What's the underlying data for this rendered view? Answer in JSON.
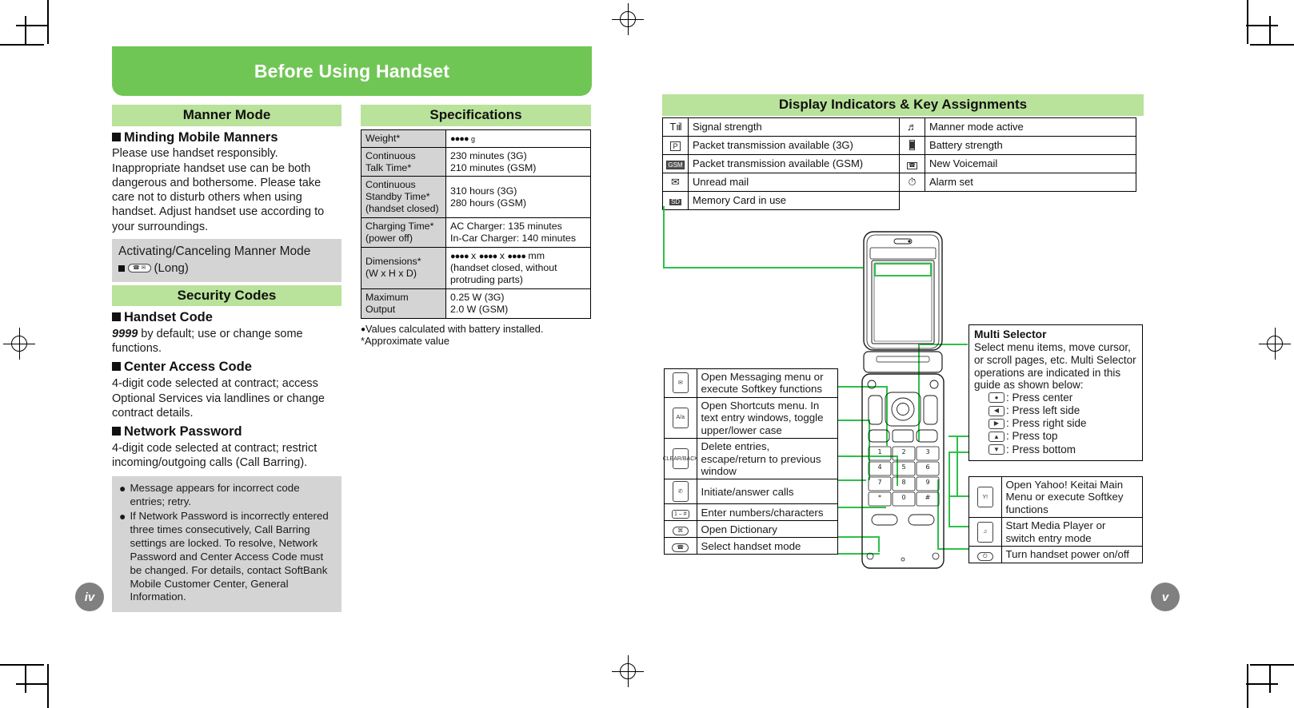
{
  "banner": {
    "title": "Before Using Handset"
  },
  "left_page": {
    "manner_mode": {
      "heading": "Manner Mode",
      "sub_heading": "Minding Mobile Manners",
      "body": "Please use handset responsibly. Inappropriate handset use can be both dangerous and bothersome. Please take care not to disturb others when using handset. Adjust handset use according to your surroundings.",
      "box_title": "Activating/Canceling Manner Mode",
      "box_key_label": "manner-key",
      "box_key_suffix": "(Long)"
    },
    "security_codes": {
      "heading": "Security Codes",
      "items": [
        {
          "title": "Handset Code",
          "emphasis": "9999",
          "body": " by default; use or change some functions."
        },
        {
          "title": "Center Access Code",
          "emphasis": "",
          "body": "4-digit code selected at contract; access Optional Services via landlines or change contract details."
        },
        {
          "title": "Network Password",
          "emphasis": "",
          "body": "4-digit code selected at contract; restrict incoming/outgoing calls (Call Barring)."
        }
      ],
      "notes": [
        "Message appears for incorrect code entries; retry.",
        "If Network Password is incorrectly entered three times consecutively, Call Barring settings are locked. To resolve, Network Password and Center Access Code must be changed. For details, contact SoftBank Mobile Customer Center, General Information."
      ]
    },
    "specifications": {
      "heading": "Specifications",
      "rows": [
        {
          "key": "Weight*",
          "value_lines": [
            "●● g"
          ]
        },
        {
          "key": "Continuous\nTalk Time*",
          "value_lines": [
            "230 minutes (3G)",
            "210 minutes (GSM)"
          ]
        },
        {
          "key": "Continuous\nStandby Time*\n(handset closed)",
          "value_lines": [
            "310 hours (3G)",
            "280 hours (GSM)"
          ]
        },
        {
          "key": "Charging Time*\n(power off)",
          "value_lines": [
            "AC Charger: 135 minutes",
            "In-Car Charger: 140 minutes"
          ]
        },
        {
          "key": "Dimensions*\n(W x H x D)",
          "value_lines": [
            "●● x ●● x ●● mm",
            "(handset closed, without",
            "protruding parts)"
          ]
        },
        {
          "key": "Maximum\nOutput",
          "value_lines": [
            "0.25 W (3G)",
            "2.0 W (GSM)"
          ]
        }
      ],
      "footnotes": [
        "Values calculated with battery installed.",
        "*Approximate value"
      ]
    }
  },
  "right_page": {
    "heading": "Display Indicators & Key Assignments",
    "indicators_left": [
      {
        "icon": "signal-strength-icon",
        "label": "Signal strength"
      },
      {
        "icon": "packet-3g-icon",
        "label": "Packet transmission available (3G)"
      },
      {
        "icon": "packet-gsm-icon",
        "label": "Packet transmission available (GSM)"
      },
      {
        "icon": "unread-mail-icon",
        "label": "Unread mail"
      },
      {
        "icon": "memory-card-icon",
        "label": "Memory Card in use"
      }
    ],
    "indicators_right": [
      {
        "icon": "manner-mode-icon",
        "label": "Manner mode active"
      },
      {
        "icon": "battery-icon",
        "label": "Battery strength"
      },
      {
        "icon": "voicemail-icon",
        "label": "New Voicemail"
      },
      {
        "icon": "alarm-icon",
        "label": "Alarm set"
      }
    ],
    "keys_left": [
      {
        "key_icon": "mail-key-icon",
        "key_caption": "✉",
        "label": "Open Messaging menu or execute Softkey functions"
      },
      {
        "key_icon": "shortcuts-key-icon",
        "key_caption": "A/a",
        "label": "Open Shortcuts menu. In text entry windows, toggle upper/lower case"
      },
      {
        "key_icon": "clear-back-key-icon",
        "key_caption": "CLEAR/BACK",
        "label": "Delete entries, escape/return to previous window"
      },
      {
        "key_icon": "call-key-icon",
        "key_caption": "✆",
        "label": "Initiate/answer calls"
      },
      {
        "key_icon": "keypad-keys-icon",
        "key_caption": "1 – #",
        "label": "Enter numbers/characters"
      },
      {
        "key_icon": "dictionary-key-icon",
        "key_caption": "⌘",
        "label": "Open Dictionary"
      },
      {
        "key_icon": "handset-mode-key-icon",
        "key_caption": "☎",
        "label": "Select handset mode"
      }
    ],
    "multi_selector": {
      "title": "Multi Selector",
      "body": "Select menu items, move cursor, or scroll pages, etc. Multi Selector operations are indicated in this guide as shown below:",
      "directions": [
        {
          "icon": "press-center-icon",
          "label": ": Press center"
        },
        {
          "icon": "press-left-icon",
          "label": ": Press left side"
        },
        {
          "icon": "press-right-icon",
          "label": ": Press right side"
        },
        {
          "icon": "press-top-icon",
          "label": ": Press top"
        },
        {
          "icon": "press-bottom-icon",
          "label": ": Press bottom"
        }
      ]
    },
    "keys_right": [
      {
        "key_icon": "yahoo-keitai-key-icon",
        "key_caption": "Y!",
        "label": "Open Yahoo! Keitai Main Menu or execute Softkey functions"
      },
      {
        "key_icon": "media-player-key-icon",
        "key_caption": "♫",
        "label": "Start Media Player or switch entry mode"
      },
      {
        "key_icon": "power-key-icon",
        "key_caption": "⏻",
        "label": "Turn handset power on/off"
      }
    ]
  },
  "page_numbers": {
    "left": "iv",
    "right": "v"
  },
  "colors": {
    "banner_green": "#70c655",
    "section_green": "#b9e29a",
    "gray_block": "#d4d4d4",
    "connector_green": "#2fbf4a",
    "page_badge": "#808080"
  }
}
